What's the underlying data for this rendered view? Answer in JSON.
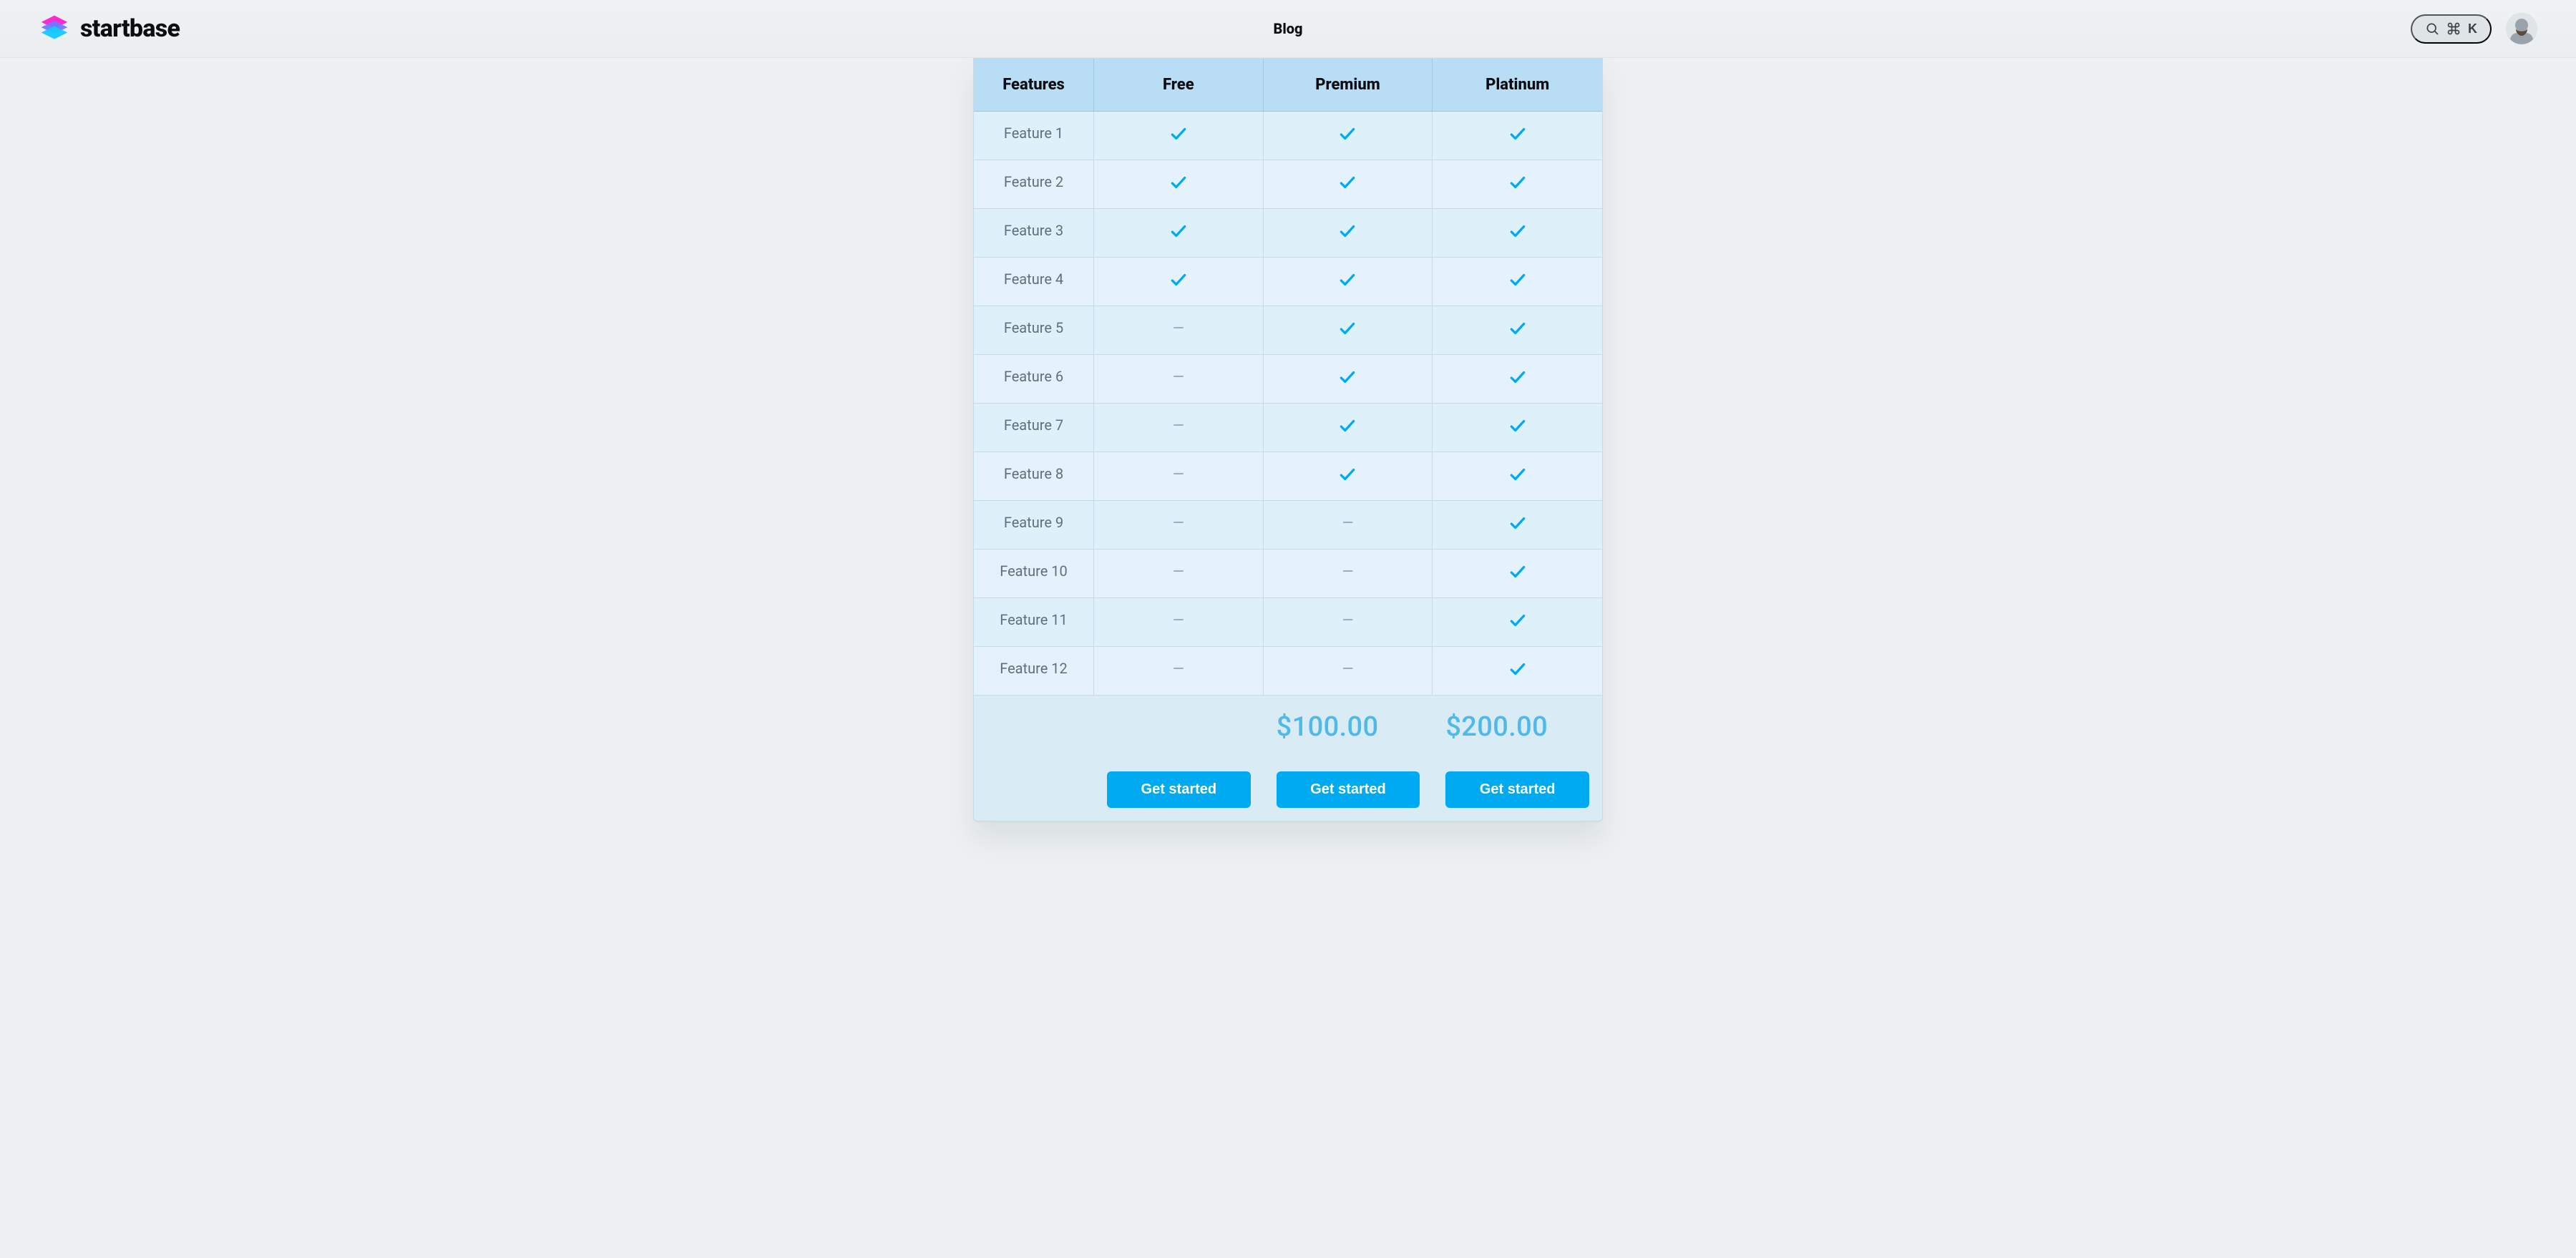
{
  "brand": {
    "name": "startbase"
  },
  "nav": {
    "blog_label": "Blog"
  },
  "header": {
    "search_chip": {
      "shortcut": "K"
    }
  },
  "table": {
    "headers": {
      "features": "Features",
      "free": "Free",
      "premium": "Premium",
      "platinum": "Platinum"
    },
    "rows": [
      {
        "name": "Feature 1",
        "free": true,
        "premium": true,
        "platinum": true
      },
      {
        "name": "Feature 2",
        "free": true,
        "premium": true,
        "platinum": true
      },
      {
        "name": "Feature 3",
        "free": true,
        "premium": true,
        "platinum": true
      },
      {
        "name": "Feature 4",
        "free": true,
        "premium": true,
        "platinum": true
      },
      {
        "name": "Feature 5",
        "free": false,
        "premium": true,
        "platinum": true
      },
      {
        "name": "Feature 6",
        "free": false,
        "premium": true,
        "platinum": true
      },
      {
        "name": "Feature 7",
        "free": false,
        "premium": true,
        "platinum": true
      },
      {
        "name": "Feature 8",
        "free": false,
        "premium": true,
        "platinum": true
      },
      {
        "name": "Feature 9",
        "free": false,
        "premium": false,
        "platinum": true
      },
      {
        "name": "Feature 10",
        "free": false,
        "premium": false,
        "platinum": true
      },
      {
        "name": "Feature 11",
        "free": false,
        "premium": false,
        "platinum": true
      },
      {
        "name": "Feature 12",
        "free": false,
        "premium": false,
        "platinum": true
      }
    ],
    "prices": {
      "free": "",
      "premium": "$100.00",
      "platinum": "$200.00"
    },
    "cta_label": "Get started"
  },
  "icons": {
    "logo": "layers-icon",
    "search": "search-icon",
    "command": "command-icon",
    "avatar": "avatar-icon",
    "check": "check-icon"
  }
}
